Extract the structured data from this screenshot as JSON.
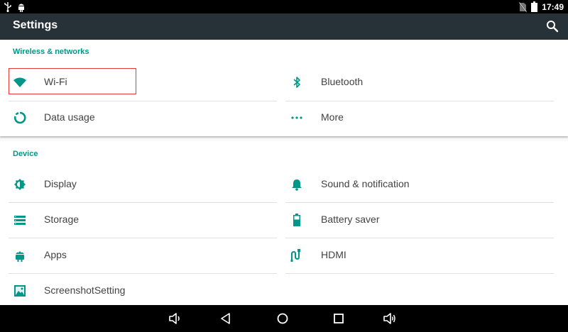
{
  "status_bar": {
    "left_icons": [
      "usb-icon",
      "android-debug-icon"
    ],
    "right_icons": [
      "no-sim-icon",
      "battery-icon"
    ],
    "time": "17:49"
  },
  "app_bar": {
    "title": "Settings",
    "search_icon": "search-icon"
  },
  "sections": [
    {
      "header": "Wireless & networks",
      "items": [
        {
          "label": "Wi-Fi",
          "icon": "wifi-icon",
          "highlighted": true
        },
        {
          "label": "Bluetooth",
          "icon": "bluetooth-icon"
        },
        {
          "label": "Data usage",
          "icon": "data-usage-icon"
        },
        {
          "label": "More",
          "icon": "more-icon"
        }
      ]
    },
    {
      "header": "Device",
      "items": [
        {
          "label": "Display",
          "icon": "display-icon"
        },
        {
          "label": "Sound & notification",
          "icon": "bell-icon"
        },
        {
          "label": "Storage",
          "icon": "storage-icon"
        },
        {
          "label": "Battery saver",
          "icon": "battery-saver-icon"
        },
        {
          "label": "Apps",
          "icon": "android-icon"
        },
        {
          "label": "HDMI",
          "icon": "hdmi-icon"
        },
        {
          "label": "ScreenshotSetting",
          "icon": "screenshot-icon"
        }
      ]
    }
  ],
  "nav_bar": {
    "buttons": [
      "volume-down-icon",
      "back-icon",
      "home-icon",
      "recents-icon",
      "volume-up-icon"
    ]
  },
  "colors": {
    "accent": "#009688",
    "app_bar": "#263238",
    "highlight_border": "#e53935"
  }
}
